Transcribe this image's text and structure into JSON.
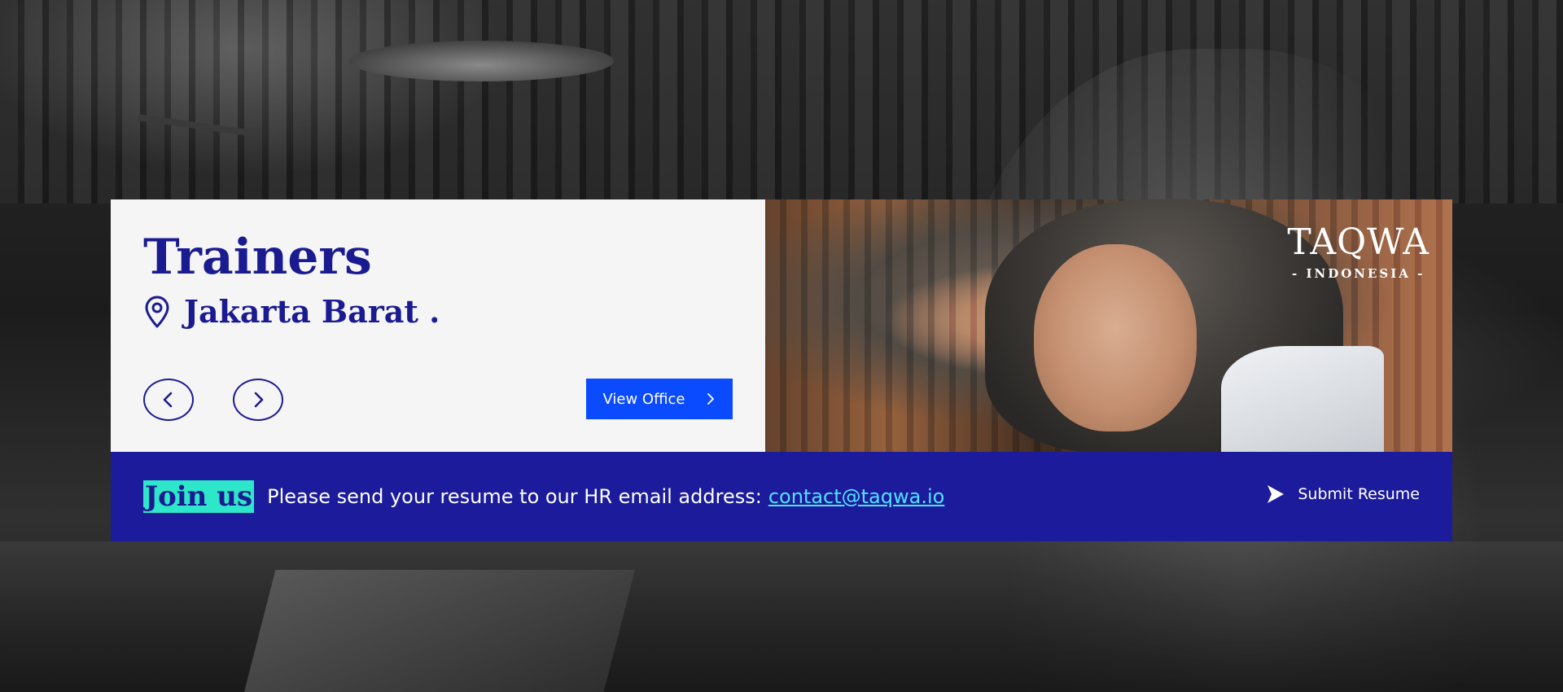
{
  "hero": {
    "title": "Trainers",
    "location": "Jakarta Barat .",
    "view_office_label": "View Office"
  },
  "logo": {
    "word": "TAQWA",
    "subtitle": "- INDONESIA -"
  },
  "join": {
    "tag": "Join us",
    "message": "Please send your resume to our HR email address:",
    "email": "contact@taqwa.io",
    "submit_label": "Submit Resume"
  },
  "icons": {
    "location": "map-pin-icon",
    "prev": "chevron-left-icon",
    "next": "chevron-right-icon",
    "view_office": "chevron-right-icon",
    "submit": "send-icon"
  },
  "colors": {
    "brand_navy": "#1b1b91",
    "bar_blue": "#1b1b9b",
    "button_blue": "#0a4bff",
    "tag_teal": "#2ee6c9",
    "link_cyan": "#52e2ff",
    "card_bg": "#f5f5f5"
  }
}
